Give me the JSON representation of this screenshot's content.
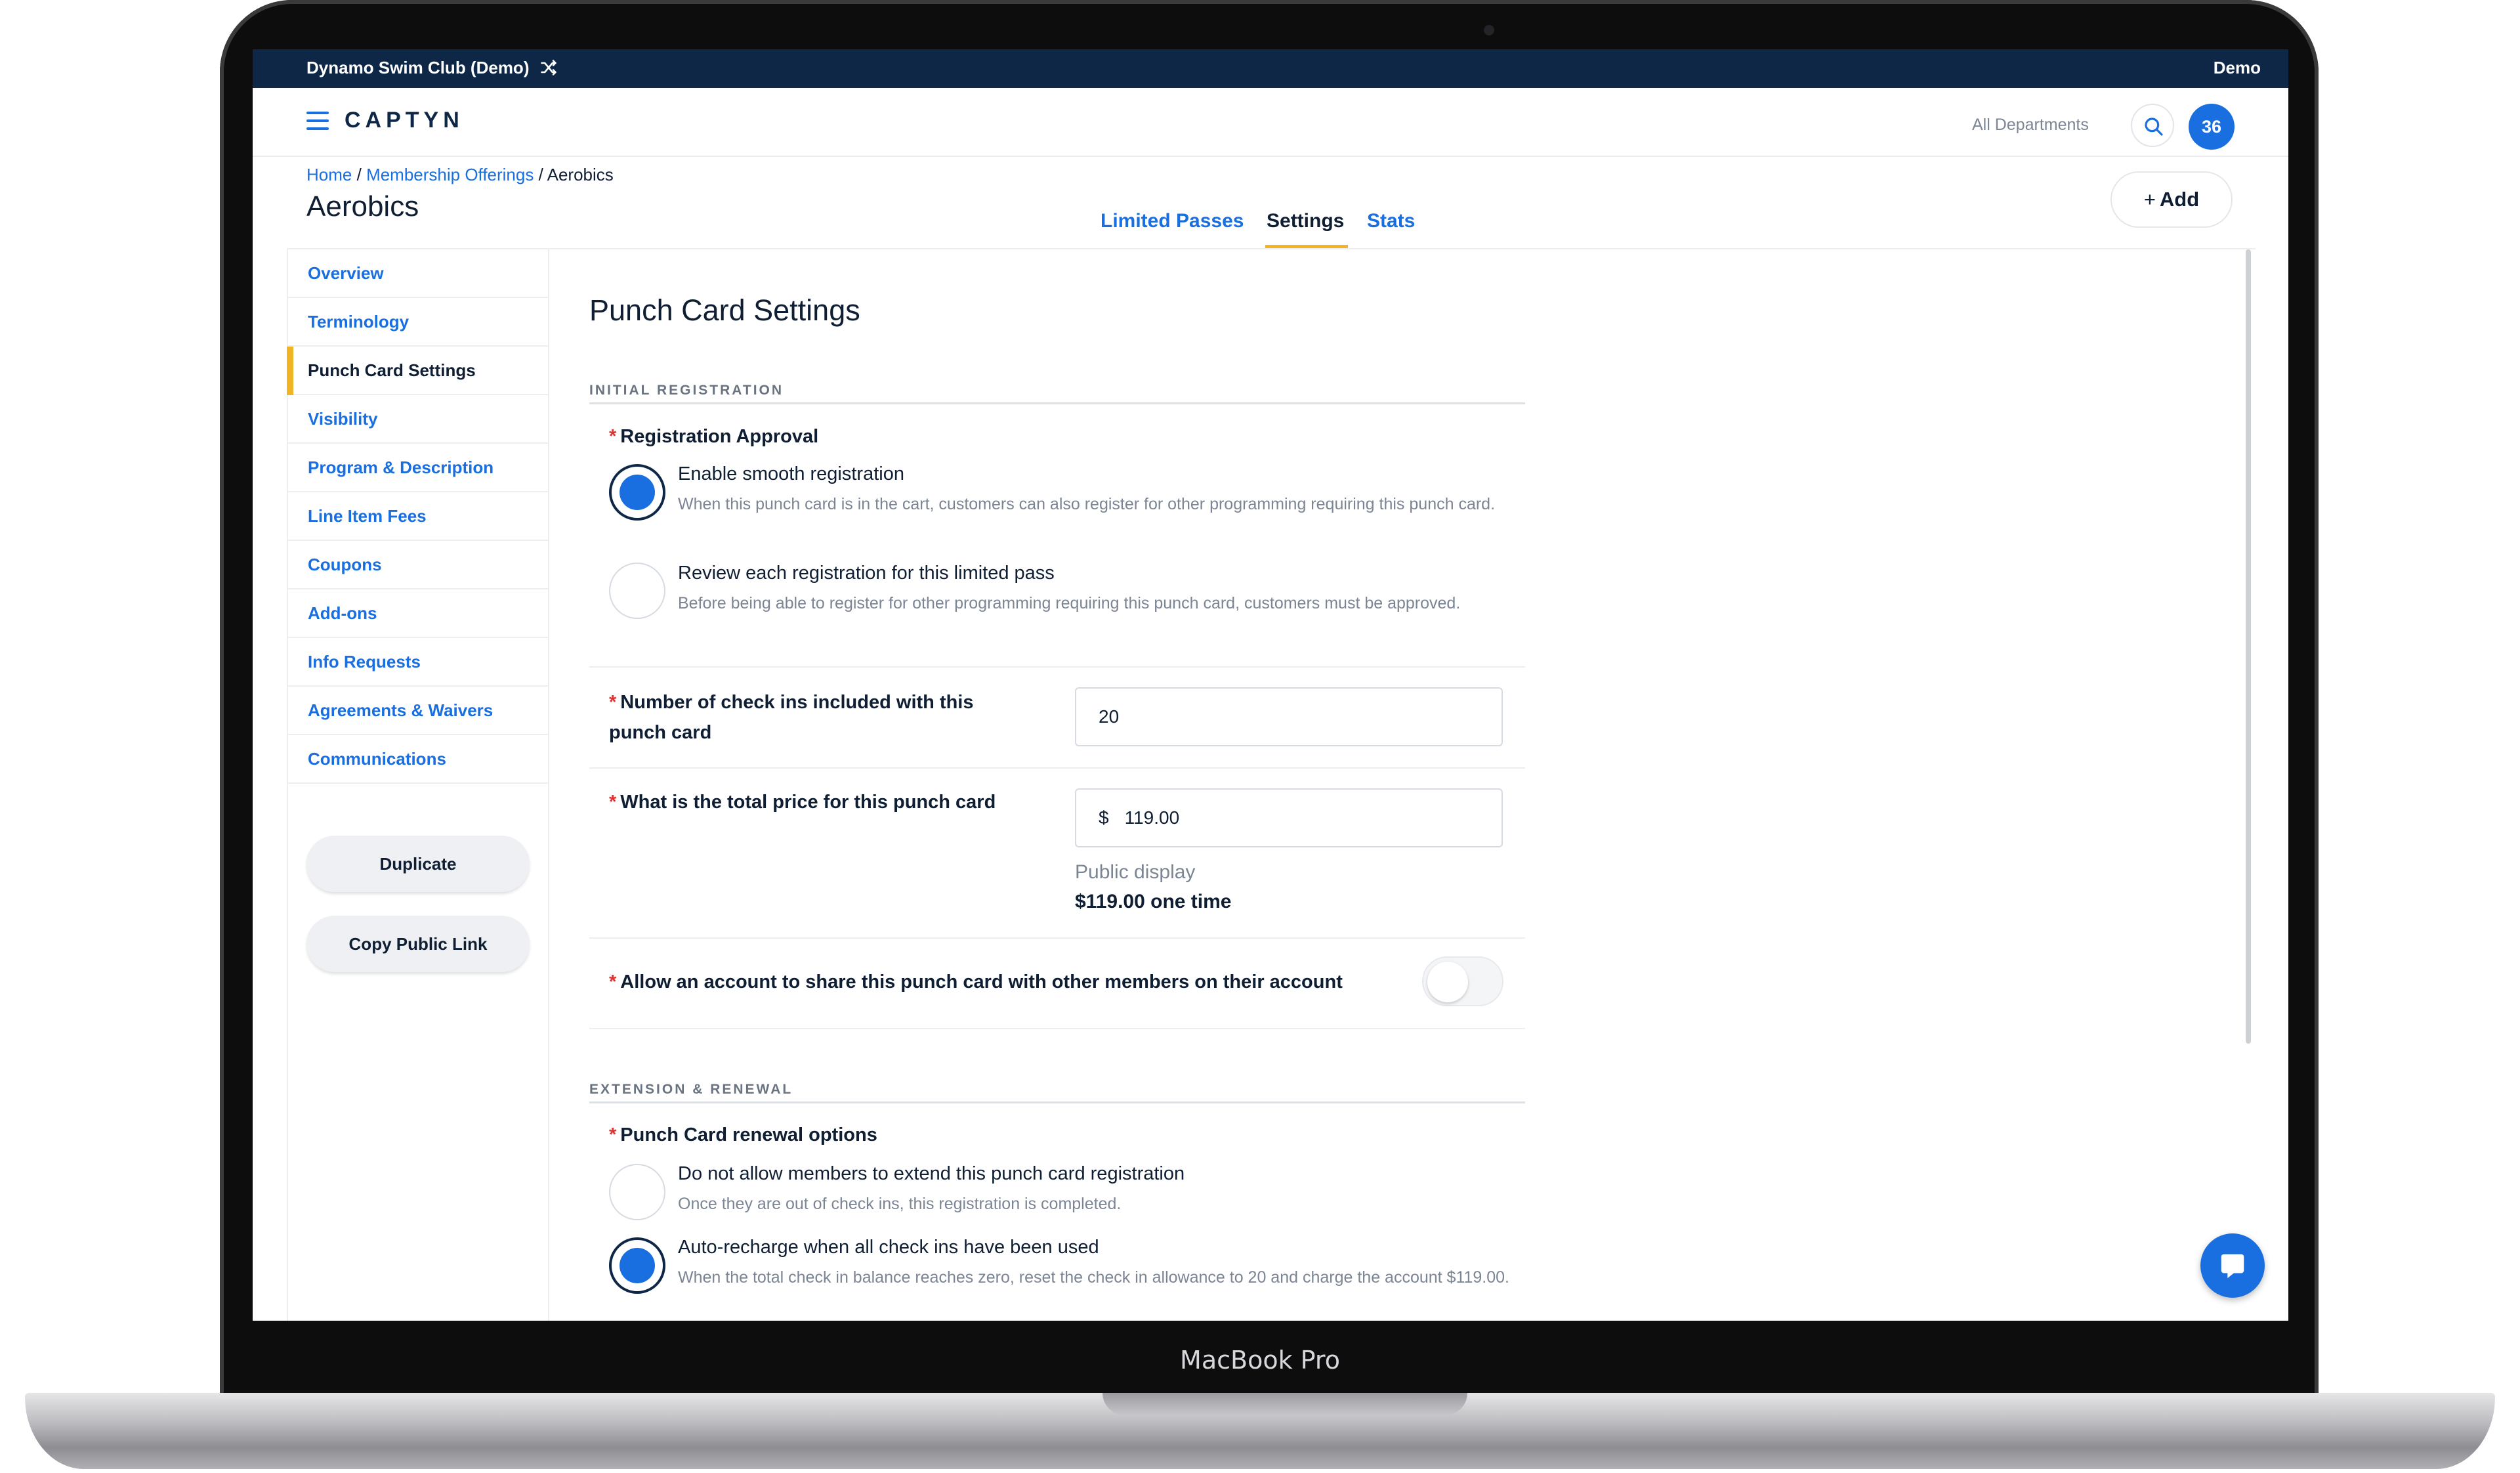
{
  "device": {
    "label": "MacBook Pro"
  },
  "topbar": {
    "organization": "Dynamo Swim Club (Demo)",
    "account": "Demo"
  },
  "header": {
    "logo": "CAPTYN",
    "department_selector": "All Departments",
    "notification_count": "36"
  },
  "breadcrumb": [
    {
      "label": "Home"
    },
    {
      "label": "Membership Offerings"
    },
    {
      "label": "Aerobics"
    }
  ],
  "breadcrumb_separator": "/",
  "page_title": "Aerobics",
  "tabs": [
    {
      "label": "Limited Passes",
      "active": false
    },
    {
      "label": "Settings",
      "active": true
    },
    {
      "label": "Stats",
      "active": false
    }
  ],
  "add_button": {
    "label": "Add"
  },
  "sidenav": {
    "items": [
      {
        "label": "Overview",
        "active": false
      },
      {
        "label": "Terminology",
        "active": false
      },
      {
        "label": "Punch Card Settings",
        "active": true
      },
      {
        "label": "Visibility",
        "active": false
      },
      {
        "label": "Program & Description",
        "active": false
      },
      {
        "label": "Line Item Fees",
        "active": false
      },
      {
        "label": "Coupons",
        "active": false
      },
      {
        "label": "Add-ons",
        "active": false
      },
      {
        "label": "Info Requests",
        "active": false
      },
      {
        "label": "Agreements & Waivers",
        "active": false
      },
      {
        "label": "Communications",
        "active": false
      }
    ],
    "duplicate_button": "Duplicate",
    "copy_link_button": "Copy Public Link"
  },
  "main": {
    "title": "Punch Card Settings",
    "initial_registration": {
      "heading": "INITIAL REGISTRATION",
      "approval_label": "Registration Approval",
      "options": [
        {
          "title": "Enable smooth registration",
          "description": "When this punch card is in the cart, customers can also register for other programming requiring this punch card.",
          "checked": true
        },
        {
          "title": "Review each registration for this limited pass",
          "description": "Before being able to register for other programming requiring this punch card, customers must be approved.",
          "checked": false
        }
      ],
      "check_ins_label": "Number of check ins included with this punch card",
      "check_ins_value": "20",
      "price_label": "What is the total price for this punch card",
      "price_currency": "$",
      "price_value": "119.00",
      "public_display_label": "Public display",
      "public_display_value": "$119.00 one time",
      "share_label": "Allow an account to share this punch card with other members on their account",
      "share_enabled": false
    },
    "extension_renewal": {
      "heading": "EXTENSION & RENEWAL",
      "renewal_label": "Punch Card renewal options",
      "options": [
        {
          "title": "Do not allow members to extend this punch card registration",
          "description": "Once they are out of check ins, this registration is completed.",
          "checked": false
        },
        {
          "title": "Auto-recharge when all check ins have been used",
          "description": "When the total check in balance reaches zero, reset the check in allowance to 20 and charge the account $119.00.",
          "checked": true
        }
      ]
    }
  },
  "required_marker": "*",
  "colors": {
    "navy": "#0f2747",
    "accent_blue": "#1a6fe0",
    "tab_underline": "#f0b429",
    "required": "#e03131"
  },
  "icons": {
    "swap": "shuffle-icon",
    "menu": "hamburger-icon",
    "search": "search-icon",
    "add": "plus-icon",
    "chat": "chat-icon"
  }
}
